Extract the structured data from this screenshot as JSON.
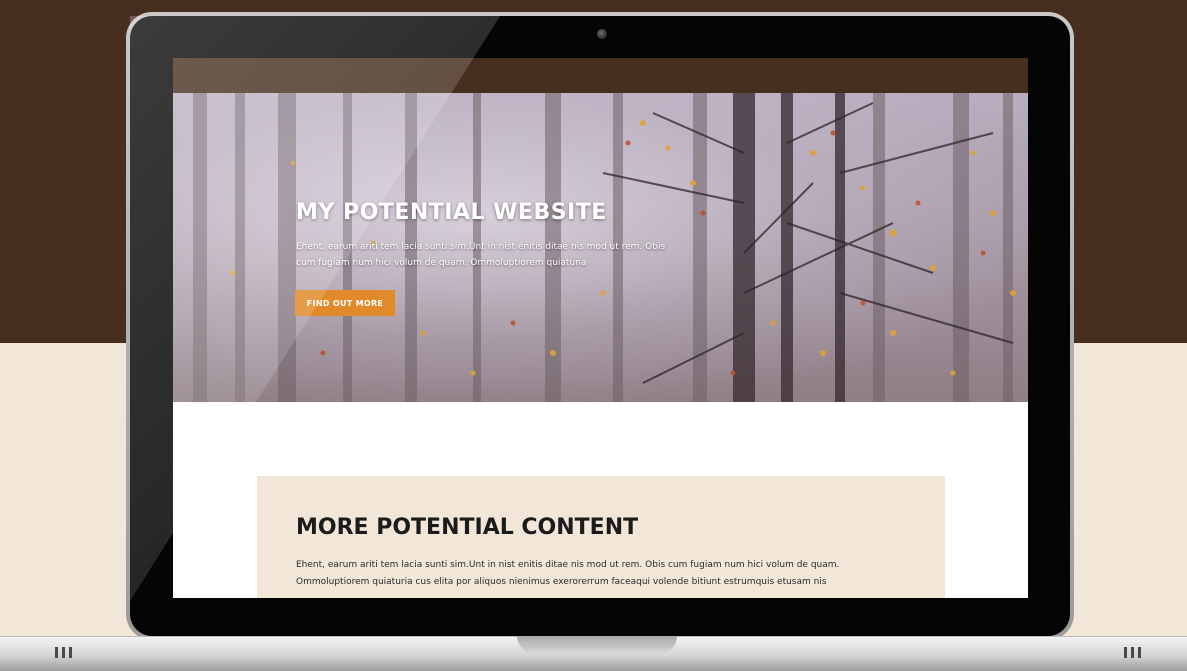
{
  "hero": {
    "title": "MY POTENTIAL WEBSITE",
    "text": "Ehent, earum ariti tem lacia sunti sim.Unt in nist enitis ditae nis mod ut rem. Obis cum fugiam num hici volum de quam. Ommoluptiorem quiatuna",
    "button_label": "FIND OUT MORE"
  },
  "content": {
    "title": "MORE POTENTIAL CONTENT",
    "text": "Ehent, earum ariti tem lacia sunti sim.Unt in nist enitis ditae nis mod ut rem. Obis cum fugiam num hici volum de quam. Ommoluptiorem quiaturia cus elita por aliquos nienimus exerorerrum faceaqui volende bitiunt estrumquis etusam nis"
  },
  "colors": {
    "brand_brown": "#472f20",
    "cream": "#f2e6d8",
    "accent_orange": "#e08a2b"
  },
  "icons": {
    "camera": "webcam-icon",
    "vents": "vent-grille-icon"
  }
}
